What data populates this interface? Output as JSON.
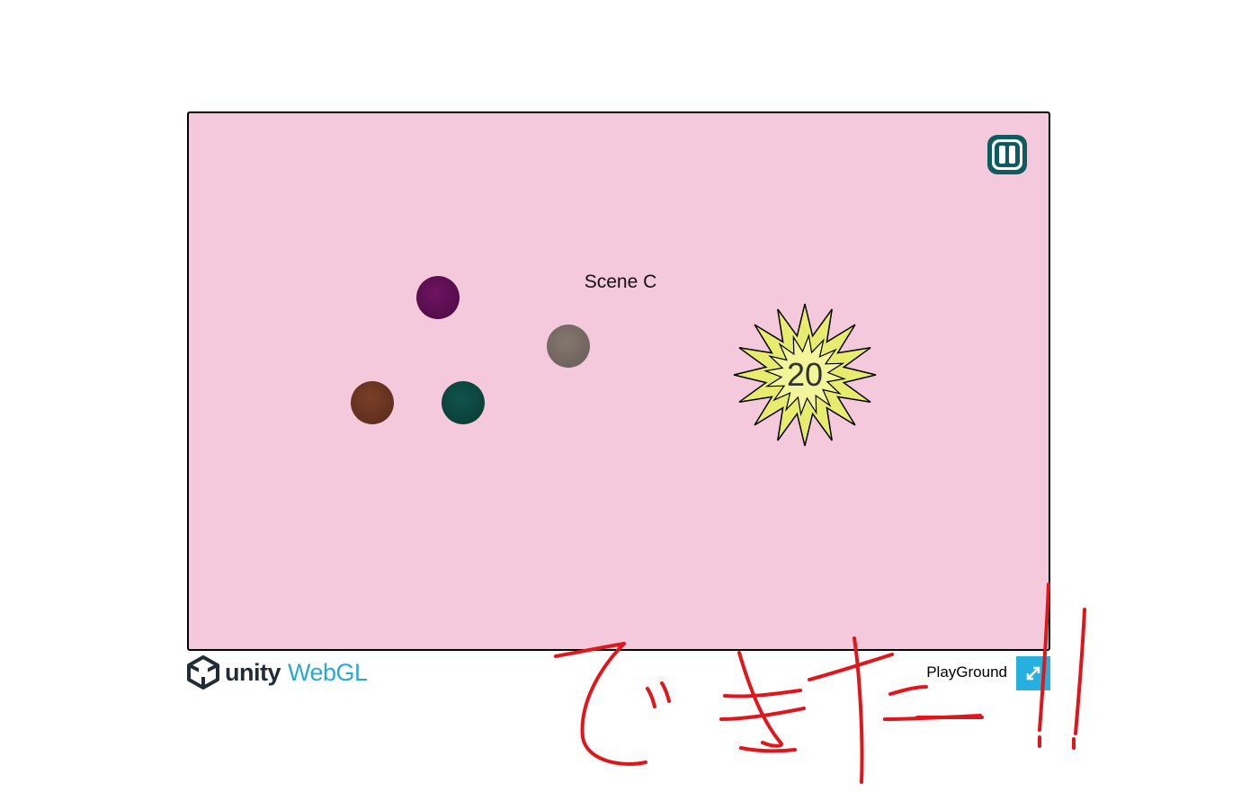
{
  "game": {
    "scene_label": "Scene C",
    "score_burst_value": "20",
    "pause_icon": "pause-icon",
    "background_color": "#f4c9dc"
  },
  "balls": [
    {
      "name": "purple-ball",
      "color": "#5e0d52"
    },
    {
      "name": "gray-ball",
      "color": "#776b66"
    },
    {
      "name": "brown-ball",
      "color": "#6a3421"
    },
    {
      "name": "teal-ball",
      "color": "#0b4540"
    }
  ],
  "footer": {
    "logo_unity": "unity",
    "logo_webgl": "WebGL",
    "title": "PlayGround",
    "fullscreen_icon": "fullscreen-icon"
  },
  "annotation": {
    "handwritten_text": "できたー!!",
    "color": "#e0161b"
  }
}
